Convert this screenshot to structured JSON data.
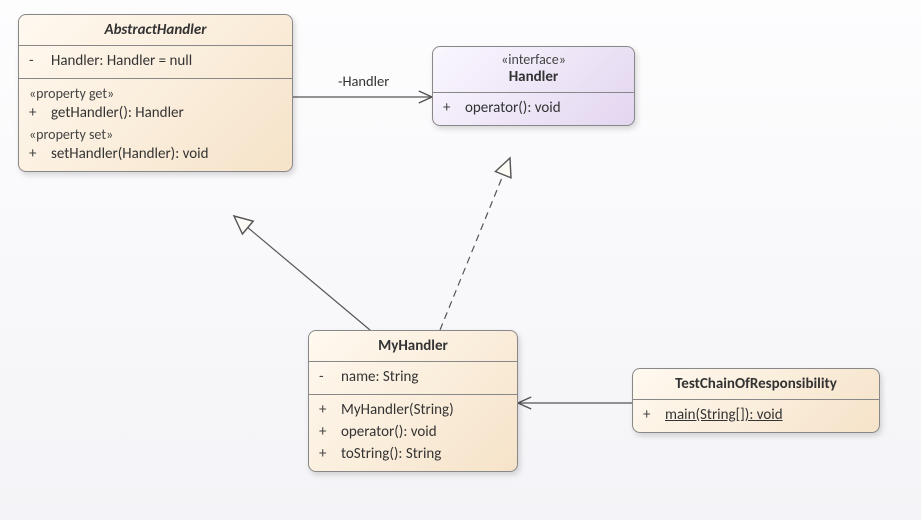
{
  "classes": {
    "abstractHandler": {
      "name": "AbstractHandler",
      "attr_vis": "-",
      "attr": "Handler: Handler = null",
      "stereo_get": "«property get»",
      "op_get_vis": "+",
      "op_get": "getHandler(): Handler",
      "stereo_set": "«property set»",
      "op_set_vis": "+",
      "op_set": "setHandler(Handler): void"
    },
    "handler": {
      "stereo": "«interface»",
      "name": "Handler",
      "op_vis": "+",
      "op": "operator(): void"
    },
    "myHandler": {
      "name": "MyHandler",
      "attr_vis": "-",
      "attr": "name: String",
      "op1_vis": "+",
      "op1": "MyHandler(String)",
      "op2_vis": "+",
      "op2": "operator(): void",
      "op3_vis": "+",
      "op3": "toString(): String"
    },
    "test": {
      "name": "TestChainOfResponsibility",
      "op_vis": "+",
      "op": "main(String[]): void"
    }
  },
  "labels": {
    "assoc1": "-Handler"
  },
  "chart_data": {
    "type": "uml_class_diagram",
    "classes": [
      {
        "id": "AbstractHandler",
        "abstract": true,
        "attributes": [
          {
            "vis": "-",
            "sig": "Handler: Handler = null"
          }
        ],
        "operations": [
          {
            "stereotype": "property get",
            "vis": "+",
            "sig": "getHandler(): Handler"
          },
          {
            "stereotype": "property set",
            "vis": "+",
            "sig": "setHandler(Handler): void"
          }
        ]
      },
      {
        "id": "Handler",
        "stereotype": "interface",
        "operations": [
          {
            "vis": "+",
            "sig": "operator(): void"
          }
        ]
      },
      {
        "id": "MyHandler",
        "attributes": [
          {
            "vis": "-",
            "sig": "name: String"
          }
        ],
        "operations": [
          {
            "vis": "+",
            "sig": "MyHandler(String)"
          },
          {
            "vis": "+",
            "sig": "operator(): void"
          },
          {
            "vis": "+",
            "sig": "toString(): String"
          }
        ]
      },
      {
        "id": "TestChainOfResponsibility",
        "operations": [
          {
            "vis": "+",
            "sig": "main(String[]): void",
            "static": true
          }
        ]
      }
    ],
    "relationships": [
      {
        "from": "AbstractHandler",
        "to": "Handler",
        "type": "association",
        "label": "-Handler",
        "arrow": "open"
      },
      {
        "from": "MyHandler",
        "to": "AbstractHandler",
        "type": "generalization"
      },
      {
        "from": "MyHandler",
        "to": "Handler",
        "type": "realization"
      },
      {
        "from": "TestChainOfResponsibility",
        "to": "MyHandler",
        "type": "association",
        "arrow": "open"
      }
    ]
  }
}
